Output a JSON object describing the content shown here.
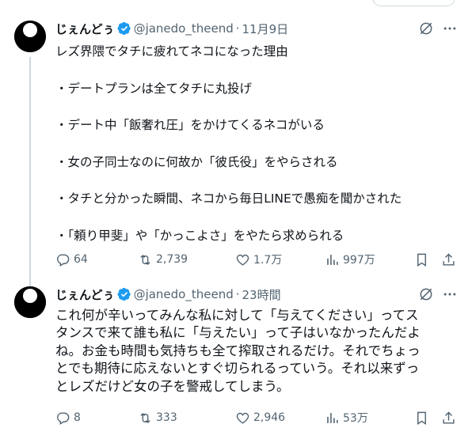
{
  "tweets": [
    {
      "author_name": "じぇんどぅ",
      "handle": "@janedo_theend",
      "separator": "·",
      "time": "11月9日",
      "lines": [
        "レズ界隈でタチに疲れてネコになった理由",
        "",
        "・デートプランは全てタチに丸投げ",
        "",
        "・デート中「飯奢れ圧」をかけてくるネコがいる",
        "",
        "・女の子同士なのに何故か「彼氏役」をやらされる",
        "",
        "・タチと分かった瞬間、ネコから毎日LINEで愚痴を聞かされた",
        "",
        "・「頼り甲斐」や「かっこよさ」をやたら求められる"
      ],
      "replies": "64",
      "retweets": "2,739",
      "likes": "1.7万",
      "views": "997万"
    },
    {
      "author_name": "じぇんどぅ",
      "handle": "@janedo_theend",
      "separator": "·",
      "time": "23時間",
      "lines": [
        "これ何が辛いってみんな私に対して「与えてください」ってス",
        "タンスで来て誰も私に「与えたい」って子はいなかったんだよ",
        "ね。お金も時間も気持ちも全て搾取されるだけ。それでちょっ",
        "とでも期待に応えないとすぐ切られるっていう。それ以来ずっ",
        "とレズだけど女の子を警戒してしまう。"
      ],
      "replies": "8",
      "retweets": "333",
      "likes": "2,946",
      "views": "53万"
    }
  ],
  "icons": {
    "verified": "verified-badge-icon",
    "grok": "grok-icon",
    "more": "more-icon",
    "reply": "reply-icon",
    "retweet": "retweet-icon",
    "like": "like-icon",
    "views": "views-icon",
    "bookmark": "bookmark-icon",
    "share": "share-icon"
  },
  "colors": {
    "text": "#0f1419",
    "secondary": "#536471",
    "verified": "#1d9bf0",
    "thread_line": "#cfd9de"
  }
}
